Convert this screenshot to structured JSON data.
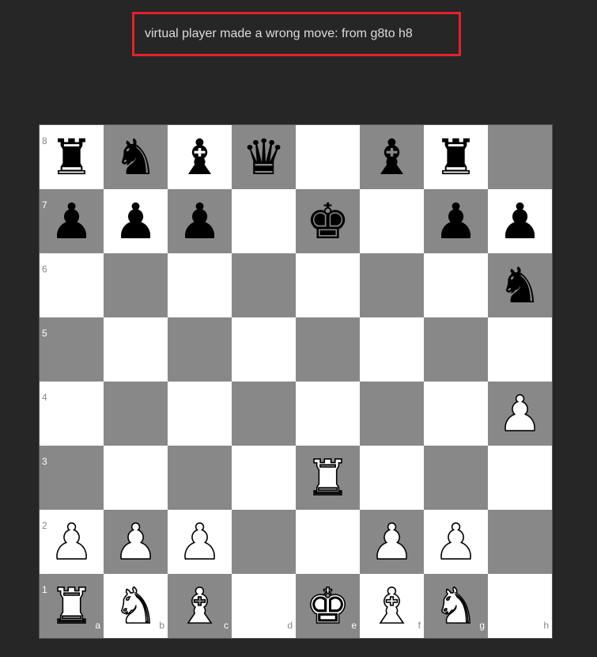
{
  "message": "virtual player made a wrong move: from g8to h8",
  "colors": {
    "light_square": "#ffffff",
    "dark_square": "#888888",
    "message_border": "#e3212b",
    "background": "#262626"
  },
  "board": {
    "files": [
      "a",
      "b",
      "c",
      "d",
      "e",
      "f",
      "g",
      "h"
    ],
    "ranks": [
      "8",
      "7",
      "6",
      "5",
      "4",
      "3",
      "2",
      "1"
    ],
    "pieces": {
      "a8": "black-rook",
      "b8": "black-knight",
      "c8": "black-bishop",
      "d8": "black-queen",
      "f8": "black-bishop",
      "g8": "black-rook",
      "a7": "black-pawn",
      "b7": "black-pawn",
      "c7": "black-pawn",
      "e7": "black-king",
      "g7": "black-pawn",
      "h7": "black-pawn",
      "h6": "black-knight",
      "h4": "white-pawn",
      "e3": "white-rook",
      "a2": "white-pawn",
      "b2": "white-pawn",
      "c2": "white-pawn",
      "f2": "white-pawn",
      "g2": "white-pawn",
      "a1": "white-rook",
      "b1": "white-knight",
      "c1": "white-bishop",
      "e1": "white-king",
      "f1": "white-bishop",
      "g1": "white-knight"
    }
  }
}
